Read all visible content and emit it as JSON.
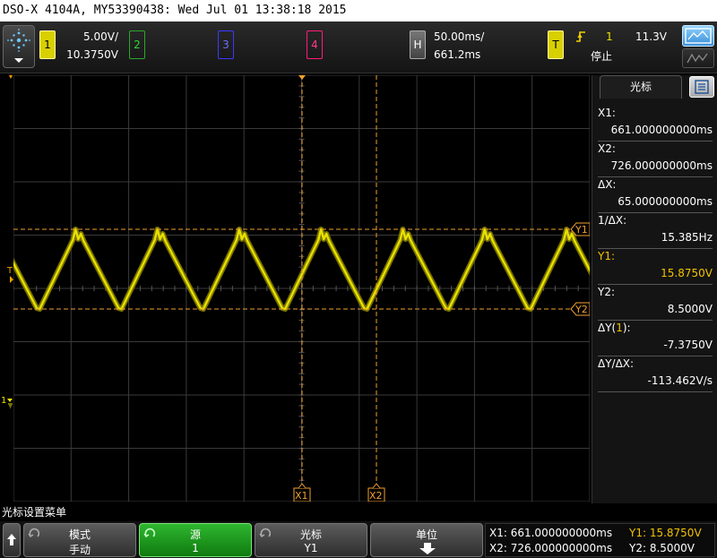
{
  "title_bar": "DSO-X 4104A, MY53390438: Wed Jul 01 13:38:18 2015",
  "channel1": {
    "number": "1",
    "scale": "5.00V/",
    "offset": "10.3750V"
  },
  "channels": {
    "ch2": "2",
    "ch3": "3",
    "ch4": "4"
  },
  "horizontal": {
    "key": "H",
    "timebase": "50.00ms/",
    "delay": "661.2ms"
  },
  "trigger": {
    "key": "T",
    "source": "1",
    "level": "11.3V",
    "status": "停止"
  },
  "cursor_markers": {
    "y1": "Y1",
    "y2": "Y2",
    "x1": "X1",
    "x2": "X2",
    "trigger_marker": "T",
    "ground_marker": "1"
  },
  "panel": {
    "tab_label": "光标",
    "x1_label": "X1:",
    "x1_value": "661.000000000ms",
    "x2_label": "X2:",
    "x2_value": "726.000000000ms",
    "dx_label": "ΔX:",
    "dx_value": "65.000000000ms",
    "inv_dx_label": "1/ΔX:",
    "inv_dx_value": "15.385Hz",
    "y1_label": "Y1:",
    "y1_value": "15.8750V",
    "y2_label": "Y2:",
    "y2_value": "8.5000V",
    "dy_label_prefix": "ΔY(",
    "dy_label_ch": "1",
    "dy_label_suffix": "):",
    "dy_value": "-7.3750V",
    "dydx_label": "ΔY/ΔX:",
    "dydx_value": "-113.462V/s"
  },
  "softmenu": {
    "title": "光标设置菜单",
    "mode_label": "模式",
    "mode_value": "手动",
    "source_label": "源",
    "source_value": "1",
    "cursor_label": "光标",
    "cursor_value": "Y1",
    "units_label": "单位"
  },
  "readout": {
    "x1": "X1: 661.000000000ms",
    "x2": "X2: 726.000000000ms",
    "y1": "Y1: 15.8750V",
    "y2": "Y2: 8.5000V"
  },
  "colors": {
    "ch1": "#e8e000",
    "cursor": "#f0a030",
    "accent_green": "#1e9c1e"
  }
}
